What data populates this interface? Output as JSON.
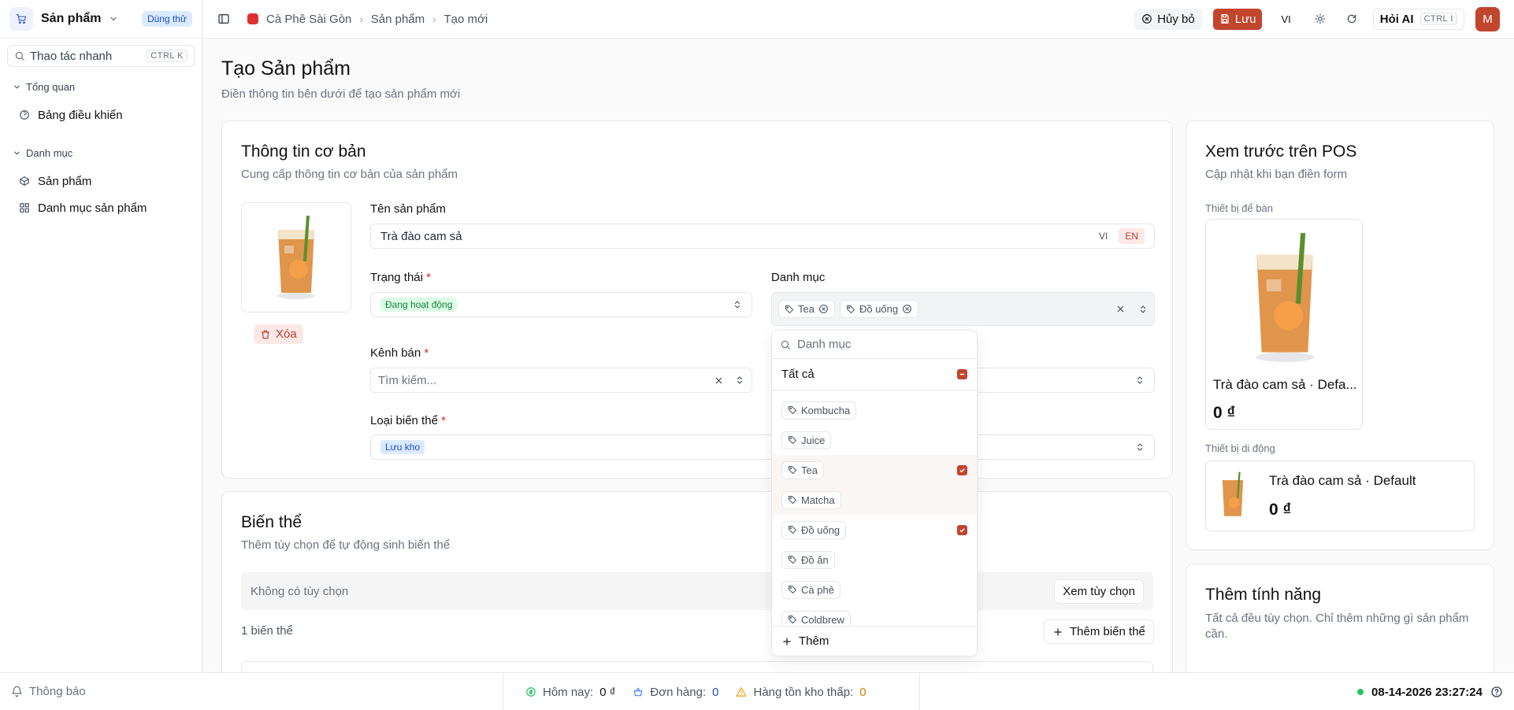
{
  "sidebar": {
    "title": "Sản phẩm",
    "trial_badge": "Dùng thử",
    "search_placeholder": "Thao tác nhanh",
    "search_shortcut": "CTRL K",
    "groups": [
      {
        "label": "Tổng quan",
        "items": [
          {
            "label": "Bảng điều khiển",
            "icon": "gauge-icon"
          }
        ]
      },
      {
        "label": "Danh mục",
        "items": [
          {
            "label": "Sản phẩm",
            "icon": "box-icon"
          },
          {
            "label": "Danh mục sản phẩm",
            "icon": "grid-icon"
          }
        ]
      }
    ],
    "footer_label": "Thông báo"
  },
  "topbar": {
    "breadcrumb": [
      "Cà Phê Sài Gòn",
      "Sản phẩm",
      "Tạo mới"
    ],
    "cancel_label": "Hủy bỏ",
    "save_label": "Lưu",
    "lang": "VI",
    "ai_label": "Hỏi AI",
    "ai_shortcut": "CTRL I",
    "avatar_initial": "M"
  },
  "page": {
    "title": "Tạo Sản phẩm",
    "subtitle": "Điền thông tin bên dưới để tạo sản phẩm mới"
  },
  "basic": {
    "title": "Thông tin cơ bản",
    "subtitle": "Cung cấp thông tin cơ bản của sản phẩm",
    "delete_label": "Xóa",
    "name_label": "Tên sản phẩm",
    "name_value": "Trà đào cam sả",
    "name_langs": [
      "VI",
      "EN"
    ],
    "status_label": "Trạng thái",
    "status_value": "Đang hoạt động",
    "category_label": "Danh mục",
    "selected_categories": [
      "Tea",
      "Đồ uống"
    ],
    "channel_label": "Kênh bán",
    "channel_placeholder": "Tìm kiếm...",
    "variant_type_label": "Loại biến thể",
    "variant_type_value": "Lưu kho",
    "required_mark": "*"
  },
  "category_dropdown": {
    "search_placeholder": "Danh mục",
    "all_label": "Tất cả",
    "options": [
      {
        "label": "Kombucha",
        "checked": false
      },
      {
        "label": "Juice",
        "checked": false
      },
      {
        "label": "Tea",
        "checked": true
      },
      {
        "label": "Matcha",
        "checked": false
      },
      {
        "label": "Đồ uống",
        "checked": true
      },
      {
        "label": "Đồ ăn",
        "checked": false
      },
      {
        "label": "Cà phê",
        "checked": false
      },
      {
        "label": "Coldbrew",
        "checked": false
      }
    ],
    "add_label": "Thêm"
  },
  "variants": {
    "title": "Biến thể",
    "subtitle": "Thêm tùy chọn để tự động sinh biến thể",
    "no_options": "Không có tùy chọn",
    "view_options_label": "Xem tùy chọn",
    "count_label": "1 biến thể",
    "add_variant_label": "Thêm biến thể"
  },
  "preview": {
    "title": "Xem trước trên POS",
    "subtitle": "Cập nhật khi bạn điền form",
    "desktop_label": "Thiết bị để bàn",
    "desktop_name": "Trà đào cam sả · Defa...",
    "desktop_price": "0 ₫",
    "mobile_label": "Thiết bị di động",
    "mobile_name": "Trà đào cam sả · Default",
    "mobile_price": "0 ₫"
  },
  "features": {
    "title": "Thêm tính năng",
    "subtitle": "Tất cả đều tùy chọn. Chỉ thêm những gì sản phẩm cần."
  },
  "statusbar": {
    "today_label": "Hôm nay:",
    "today_value": "0 ₫",
    "orders_label": "Đơn hàng:",
    "orders_value": "0",
    "low_stock_label": "Hàng tồn kho thấp:",
    "low_stock_value": "0",
    "datetime": "08-14-2026 23:27:24"
  },
  "colors": {
    "accent": "#c2452d",
    "brand_blue": "#1d4ed8"
  }
}
